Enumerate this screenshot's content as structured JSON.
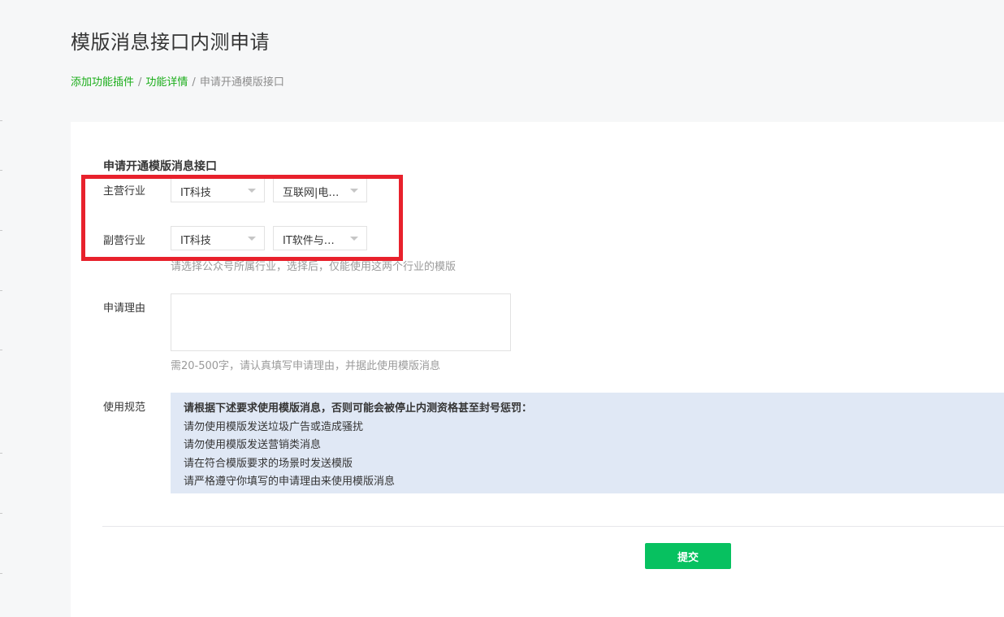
{
  "page": {
    "title": "模版消息接口内测申请"
  },
  "breadcrumb": {
    "items": [
      "添加功能插件",
      "功能详情"
    ],
    "current": "申请开通模版接口",
    "separator": "/"
  },
  "form": {
    "section_title": "申请开通模版消息接口",
    "primary_industry": {
      "label": "主营行业",
      "category": "IT科技",
      "subcategory": "互联网|电…"
    },
    "secondary_industry": {
      "label": "副营行业",
      "category": "IT科技",
      "subcategory": "IT软件与…"
    },
    "industry_hint": "请选择公众号所属行业，选择后，仅能使用这两个行业的模版",
    "reason": {
      "label": "申请理由",
      "value": "",
      "hint": "需20-500字，请认真填写申请理由，并据此使用模版消息"
    },
    "rules": {
      "label": "使用规范",
      "heading": "请根据下述要求使用模版消息，否则可能会被停止内测资格甚至封号惩罚：",
      "items": [
        "请勿使用模版发送垃圾广告或造成骚扰",
        "请勿使用模版发送营销类消息",
        "请在符合模版要求的场景时发送模版",
        "请严格遵守你填写的申请理由来使用模版消息"
      ]
    },
    "submit_label": "提交"
  },
  "colors": {
    "accent_green": "#1aad19",
    "button_green": "#07c160",
    "highlight_red": "#e8212c",
    "rules_bg": "#e0e8f5"
  }
}
